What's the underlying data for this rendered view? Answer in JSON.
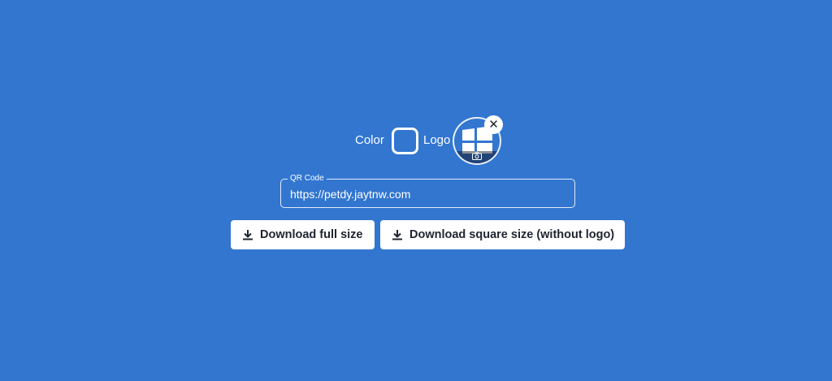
{
  "controls": {
    "color_label": "Color",
    "logo_label": "Logo",
    "color_value": "#3276d0"
  },
  "icons": {
    "remove_logo": "close-icon",
    "camera": "camera-icon",
    "download": "download-icon"
  },
  "qr": {
    "label": "QR Code",
    "value": "https://petdy.jaytnw.com"
  },
  "buttons": {
    "full": "Download full size",
    "square": "Download square size (without logo)"
  }
}
